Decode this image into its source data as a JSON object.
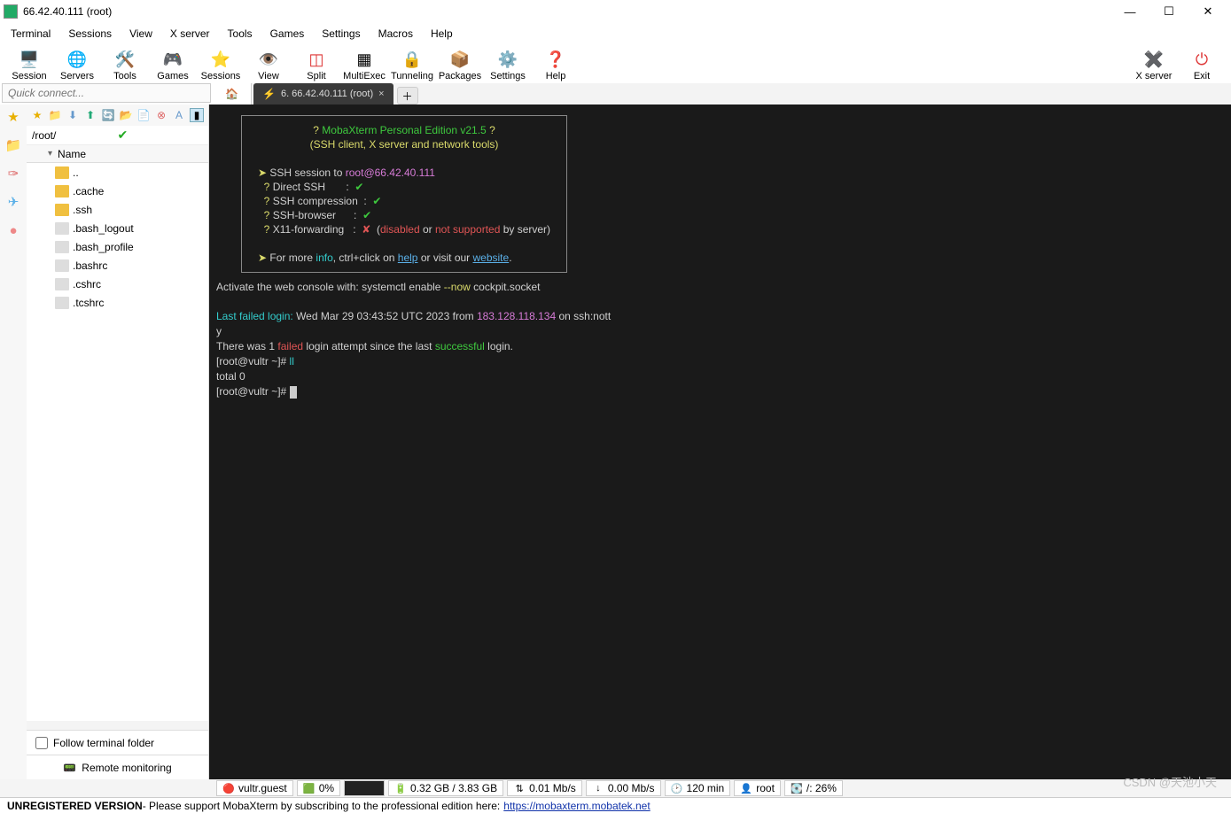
{
  "window": {
    "title": "66.42.40.111 (root)"
  },
  "menu": [
    "Terminal",
    "Sessions",
    "View",
    "X server",
    "Tools",
    "Games",
    "Settings",
    "Macros",
    "Help"
  ],
  "toolbar": [
    {
      "icon": "🖥️",
      "label": "Session"
    },
    {
      "icon": "🌐",
      "label": "Servers"
    },
    {
      "icon": "🛠️",
      "label": "Tools"
    },
    {
      "icon": "🎮",
      "label": "Games"
    },
    {
      "icon": "⭐",
      "label": "Sessions"
    },
    {
      "icon": "👁️",
      "label": "View"
    },
    {
      "icon": "◫",
      "label": "Split"
    },
    {
      "icon": "▦",
      "label": "MultiExec"
    },
    {
      "icon": "🔒",
      "label": "Tunneling"
    },
    {
      "icon": "📦",
      "label": "Packages"
    },
    {
      "icon": "⚙️",
      "label": "Settings"
    },
    {
      "icon": "❓",
      "label": "Help"
    }
  ],
  "toolbar_right": [
    {
      "icon": "✖️",
      "label": "X server",
      "color": "#2a7"
    },
    {
      "icon": "⏻",
      "label": "Exit",
      "color": "#d33"
    }
  ],
  "quick_connect_placeholder": "Quick connect...",
  "side": {
    "path": "/root/",
    "header": "Name",
    "items": [
      {
        "name": "..",
        "type": "folder"
      },
      {
        "name": ".cache",
        "type": "folder"
      },
      {
        "name": ".ssh",
        "type": "folder"
      },
      {
        "name": ".bash_logout",
        "type": "file"
      },
      {
        "name": ".bash_profile",
        "type": "file"
      },
      {
        "name": ".bashrc",
        "type": "file"
      },
      {
        "name": ".cshrc",
        "type": "file"
      },
      {
        "name": ".tcshrc",
        "type": "file"
      }
    ],
    "follow": "Follow terminal folder",
    "remote": "Remote monitoring"
  },
  "tab": {
    "title": "6. 66.42.40.111 (root)"
  },
  "banner": {
    "line1_q": "?",
    "line1": " MobaXterm Personal Edition v21.5 ",
    "line1_q2": "?",
    "line2": "(SSH client, X server and network tools)",
    "sess_pre": "SSH session to ",
    "sess_tgt": "root@66.42.40.111",
    "checks": [
      {
        "q": "?",
        "label": "Direct SSH",
        "ok": true
      },
      {
        "q": "?",
        "label": "SSH compression",
        "ok": true
      },
      {
        "q": "?",
        "label": "SSH-browser",
        "ok": true
      },
      {
        "q": "?",
        "label": "X11-forwarding",
        "ok": false,
        "extra_open": "(",
        "extra1": "disabled",
        "extra_mid": " or ",
        "extra2": "not supported",
        "extra_end": " by server)"
      }
    ],
    "more_pre": "For more ",
    "more_info": "info",
    "more_mid": ", ctrl+click on ",
    "more_help": "help",
    "more_mid2": " or visit our ",
    "more_site": "website",
    "more_end": "."
  },
  "term": {
    "l1a": "Activate the web console with: systemctl enable ",
    "l1b": "--now",
    "l1c": " cockpit.socket",
    "l2a": "Last failed login:",
    "l2b": " Wed Mar 29 03:43:52 UTC 2023 from ",
    "l2c": "183.128.118.134",
    "l2d": " on ssh:nott",
    "l3": "y",
    "l4a": "There was 1 ",
    "l4b": "failed",
    "l4c": " login attempt since the last ",
    "l4d": "successful",
    "l4e": " login.",
    "l5a": "[root@vultr ~]# ",
    "l5b": "ll",
    "l6": "total 0",
    "l7": "[root@vultr ~]# "
  },
  "status": [
    {
      "icon": "🔴",
      "text": "vultr.guest"
    },
    {
      "icon": "🟩",
      "text": "0%"
    },
    {
      "icon": "▓",
      "text": ""
    },
    {
      "icon": "🔋",
      "text": "0.32 GB / 3.83 GB"
    },
    {
      "icon": "⇅",
      "text": "0.01 Mb/s"
    },
    {
      "icon": "↓",
      "text": "0.00 Mb/s"
    },
    {
      "icon": "🕑",
      "text": "120 min"
    },
    {
      "icon": "👤",
      "text": "root"
    },
    {
      "icon": "💽",
      "text": "/: 26%"
    }
  ],
  "footer": {
    "bold": "UNREGISTERED VERSION",
    "text": "  -  Please support MobaXterm by subscribing to the professional edition here:",
    "url": "https://mobaxterm.mobatek.net"
  },
  "watermark": "CSDN @天池小天"
}
